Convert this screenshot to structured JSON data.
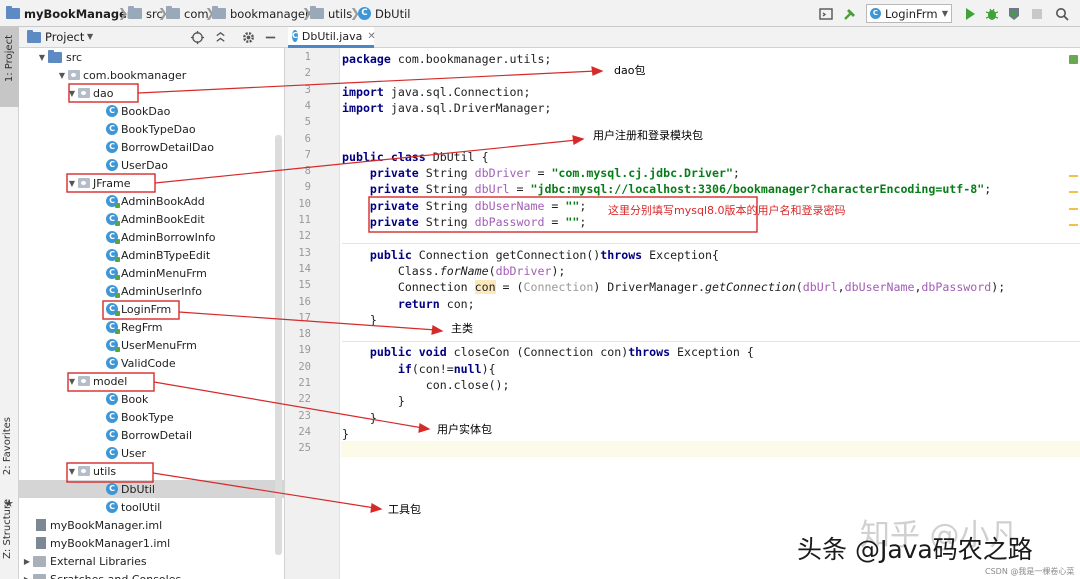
{
  "breadcrumb": {
    "project": "myBookManager",
    "src": "src",
    "com": "com",
    "bookmanager": "bookmanager",
    "utils": "utils",
    "file": "DbUtil"
  },
  "toolbar": {
    "run_config": "LoginFrm"
  },
  "left_stripe": {
    "project_tab": "1: Project",
    "favorites_tab": "2: Favorites",
    "structure_tab": "Z: Structure"
  },
  "project_panel": {
    "title": "Project",
    "tree": [
      {
        "label": "src",
        "kind": "folder",
        "level": 1,
        "open": true
      },
      {
        "label": "com.bookmanager",
        "kind": "package",
        "level": 2,
        "open": true
      },
      {
        "label": "dao",
        "kind": "package",
        "level": 3,
        "open": true
      },
      {
        "label": "BookDao",
        "kind": "class",
        "level": 4
      },
      {
        "label": "BookTypeDao",
        "kind": "class",
        "level": 4
      },
      {
        "label": "BorrowDetailDao",
        "kind": "class",
        "level": 4
      },
      {
        "label": "UserDao",
        "kind": "class",
        "level": 4
      },
      {
        "label": "JFrame",
        "kind": "package",
        "level": 3,
        "open": true
      },
      {
        "label": "AdminBookAdd",
        "kind": "runclass",
        "level": 4
      },
      {
        "label": "AdminBookEdit",
        "kind": "runclass",
        "level": 4
      },
      {
        "label": "AdminBorrowInfo",
        "kind": "runclass",
        "level": 4
      },
      {
        "label": "AdminBTypeEdit",
        "kind": "runclass",
        "level": 4
      },
      {
        "label": "AdminMenuFrm",
        "kind": "runclass",
        "level": 4
      },
      {
        "label": "AdminUserInfo",
        "kind": "runclass",
        "level": 4
      },
      {
        "label": "LoginFrm",
        "kind": "runclass",
        "level": 4
      },
      {
        "label": "RegFrm",
        "kind": "runclass",
        "level": 4
      },
      {
        "label": "UserMenuFrm",
        "kind": "runclass",
        "level": 4
      },
      {
        "label": "ValidCode",
        "kind": "class",
        "level": 4
      },
      {
        "label": "model",
        "kind": "package",
        "level": 3,
        "open": true
      },
      {
        "label": "Book",
        "kind": "class",
        "level": 4
      },
      {
        "label": "BookType",
        "kind": "class",
        "level": 4
      },
      {
        "label": "BorrowDetail",
        "kind": "class",
        "level": 4
      },
      {
        "label": "User",
        "kind": "class",
        "level": 4
      },
      {
        "label": "utils",
        "kind": "package",
        "level": 3,
        "open": true
      },
      {
        "label": "DbUtil",
        "kind": "class",
        "level": 4,
        "selected": true
      },
      {
        "label": "toolUtil",
        "kind": "class",
        "level": 4
      },
      {
        "label": "myBookManager.iml",
        "kind": "iml",
        "level": 1
      },
      {
        "label": "myBookManager1.iml",
        "kind": "iml",
        "level": 1
      },
      {
        "label": "External Libraries",
        "kind": "lib",
        "level": 0,
        "open": false
      },
      {
        "label": "Scratches and Consoles",
        "kind": "lib",
        "level": 0,
        "open": false
      }
    ]
  },
  "editor": {
    "tab_label": "DbUtil.java",
    "line_numbers": [
      "1",
      "2",
      "3",
      "4",
      "5",
      "6",
      "7",
      "8",
      "9",
      "10",
      "11",
      "12",
      "13",
      "14",
      "15",
      "16",
      "17",
      "18",
      "19",
      "20",
      "21",
      "22",
      "23",
      "24",
      "25"
    ],
    "lines": [
      [
        [
          "kw",
          "package"
        ],
        [
          "n",
          " com.bookmanager.utils;"
        ]
      ],
      [],
      [
        [
          "kw",
          "import"
        ],
        [
          "n",
          " java.sql.Connection;"
        ]
      ],
      [
        [
          "kw",
          "import"
        ],
        [
          "n",
          " java.sql.DriverManager;"
        ]
      ],
      [],
      [],
      [
        [
          "kw",
          "public class"
        ],
        [
          "n",
          " DbUtil {"
        ]
      ],
      [
        [
          "n",
          "    "
        ],
        [
          "kw",
          "private"
        ],
        [
          "n",
          " String "
        ],
        [
          "fld",
          "dbDriver"
        ],
        [
          "n",
          " = "
        ],
        [
          "str",
          "\"com.mysql.cj.jdbc.Driver\""
        ],
        [
          "n",
          ";"
        ]
      ],
      [
        [
          "n",
          "    "
        ],
        [
          "kw",
          "private"
        ],
        [
          "n",
          " String "
        ],
        [
          "fld",
          "dbUrl"
        ],
        [
          "n",
          " = "
        ],
        [
          "str",
          "\"jdbc:mysql://localhost:3306/bookmanager?characterEncoding=utf-8\""
        ],
        [
          "n",
          ";"
        ]
      ],
      [
        [
          "n",
          "    "
        ],
        [
          "kw",
          "private"
        ],
        [
          "n",
          " String "
        ],
        [
          "fld",
          "dbUserName"
        ],
        [
          "n",
          " = "
        ],
        [
          "str",
          "\"\""
        ],
        [
          "n",
          ";"
        ]
      ],
      [
        [
          "n",
          "    "
        ],
        [
          "kw",
          "private"
        ],
        [
          "n",
          " String "
        ],
        [
          "fld",
          "dbPassword"
        ],
        [
          "n",
          " = "
        ],
        [
          "str",
          "\"\""
        ],
        [
          "n",
          ";"
        ]
      ],
      [],
      [
        [
          "n",
          "    "
        ],
        [
          "kw",
          "public"
        ],
        [
          "n",
          " Connection getConnection()"
        ],
        [
          "kw",
          "throws"
        ],
        [
          "n",
          " Exception{"
        ]
      ],
      [
        [
          "n",
          "        Class."
        ],
        [
          "mth",
          "forName"
        ],
        [
          "n",
          "("
        ],
        [
          "fld",
          "dbDriver"
        ],
        [
          "n",
          ");"
        ]
      ],
      [
        [
          "n",
          "        Connection "
        ],
        [
          "hl",
          "con"
        ],
        [
          "n",
          " = ("
        ],
        [
          "hint",
          "Connection"
        ],
        [
          "n",
          ") DriverManager."
        ],
        [
          "mth",
          "getConnection"
        ],
        [
          "n",
          "("
        ],
        [
          "fld",
          "dbUrl"
        ],
        [
          "n",
          ","
        ],
        [
          "fld",
          "dbUserName"
        ],
        [
          "n",
          ","
        ],
        [
          "fld",
          "dbPassword"
        ],
        [
          "n",
          ");"
        ]
      ],
      [
        [
          "n",
          "        "
        ],
        [
          "kw",
          "return"
        ],
        [
          "n",
          " con;"
        ]
      ],
      [
        [
          "n",
          "    }"
        ]
      ],
      [],
      [
        [
          "n",
          "    "
        ],
        [
          "kw",
          "public void"
        ],
        [
          "n",
          " closeCon (Connection con)"
        ],
        [
          "kw",
          "throws"
        ],
        [
          "n",
          " Exception {"
        ]
      ],
      [
        [
          "n",
          "        "
        ],
        [
          "kw",
          "if"
        ],
        [
          "n",
          "(con!="
        ],
        [
          "kw",
          "null"
        ],
        [
          "n",
          "){"
        ]
      ],
      [
        [
          "n",
          "            con.close();"
        ]
      ],
      [
        [
          "n",
          "        }"
        ]
      ],
      [
        [
          "n",
          "    }"
        ]
      ],
      [
        [
          "n",
          "}"
        ]
      ],
      []
    ]
  },
  "annotations": {
    "dao_label": "dao包",
    "jframe_label": "用户注册和登录模块包",
    "credentials_label": "这里分别填写mysql8.0版本的用户名和登录密码",
    "main_label": "主类",
    "model_label": "用户实体包",
    "utils_label": "工具包"
  },
  "watermarks": {
    "zhihu": "知乎 @小凡",
    "toutiao": "头条 @Java码农之路",
    "csdn": "CSDN @我是一棵卷心菜"
  },
  "colors": {
    "annotation_red": "#d62a2a",
    "keyword": "#000080",
    "field": "#a15db5",
    "string": "#067d17",
    "run_green": "#3fa33a",
    "selection": "#d5d5d5"
  }
}
